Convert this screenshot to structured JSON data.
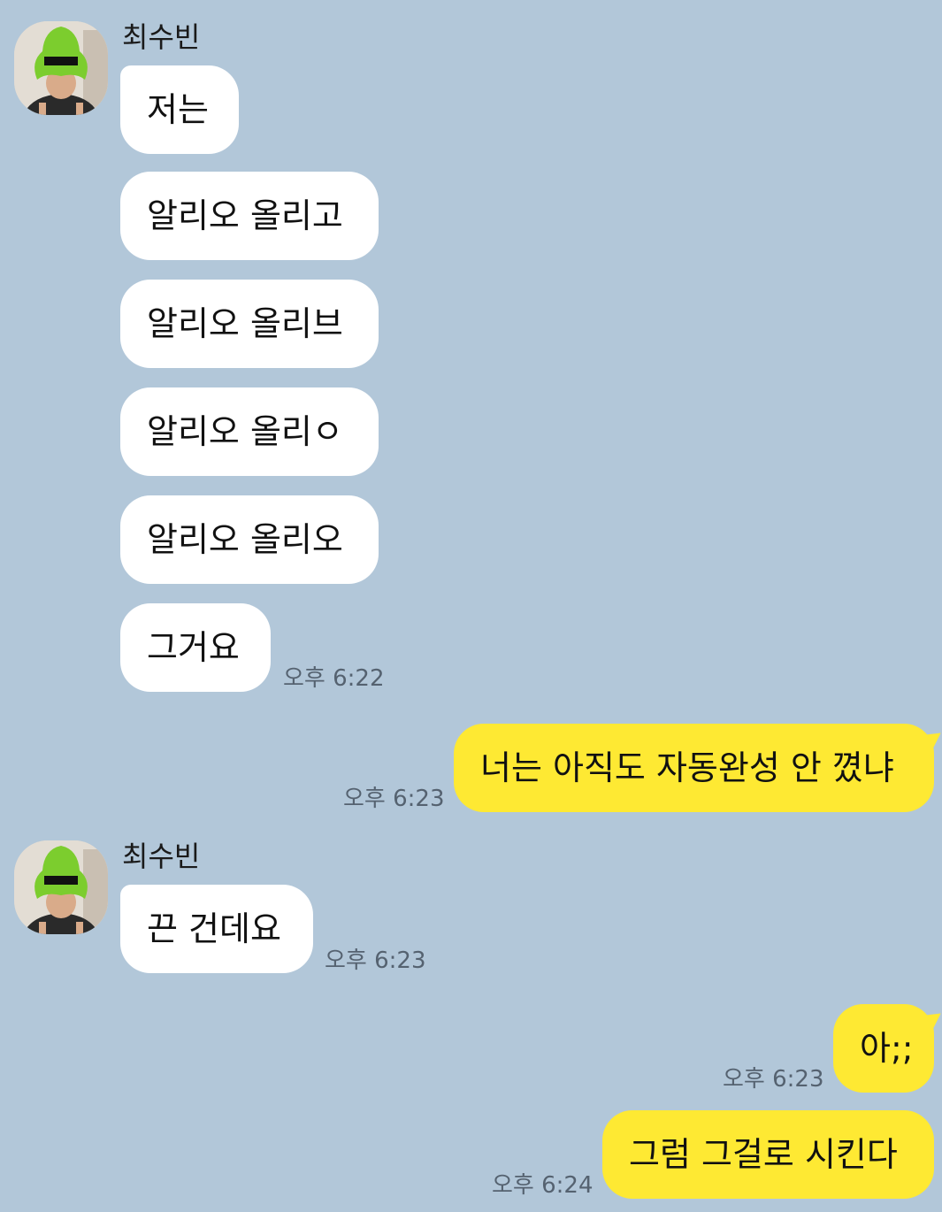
{
  "sender": {
    "name": "최수빈"
  },
  "messages": {
    "m1": "저는",
    "m2": "알리오 올리고",
    "m3": "알리오 올리브",
    "m4": "알리오 올리ㅇ",
    "m5": "알리오 올리오",
    "m6": "그거요",
    "m7": "너는 아직도 자동완성 안 꼈냐",
    "m8": "끈 건데요",
    "m9": "아;;",
    "m10": "그럼 그걸로 시킨다"
  },
  "times": {
    "t1": "오후 6:22",
    "t2": "오후 6:23",
    "t3": "오후 6:23",
    "t4": "오후 6:23",
    "t5": "오후 6:24"
  },
  "colors": {
    "background": "#b2c7d9",
    "incoming_bubble": "#ffffff",
    "outgoing_bubble": "#fee933"
  }
}
